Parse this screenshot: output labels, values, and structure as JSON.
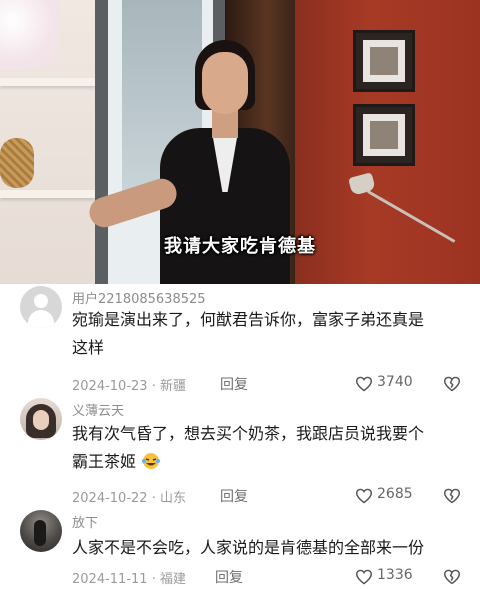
{
  "video": {
    "subtitle": "我请大家吃肯德基"
  },
  "comments": [
    {
      "avatar": "default-user-avatar",
      "username": "用户2218085638525",
      "text_line1": "宛瑜是演出来了，何猷君告诉你，富家子弟还真是",
      "text_line2": "这样",
      "date": "2024-10-23",
      "location": "新疆",
      "reply_label": "回复",
      "likes": "3740"
    },
    {
      "avatar": "girl-avatar",
      "username": "义薄云天",
      "text_line1": "我有次气昏了，想去买个奶茶，我跟店员说我要个",
      "text_line2": "霸王茶姬",
      "emoji": "crying-laughing-emoji",
      "date": "2024-10-22",
      "location": "山东",
      "reply_label": "回复",
      "likes": "2685"
    },
    {
      "avatar": "dark-photo-avatar",
      "username": "放下",
      "text_line1": "人家不是不会吃，人家说的是肯德基的全部来一份",
      "date": "2024-11-11",
      "location": "福建",
      "reply_label": "回复",
      "likes": "1336"
    }
  ],
  "colors": {
    "text": "#1a1a1a",
    "meta": "#9a9a9a",
    "username": "#8c8c8c"
  },
  "icons": {
    "like": "heart-outline-icon",
    "dislike": "broken-heart-icon"
  }
}
